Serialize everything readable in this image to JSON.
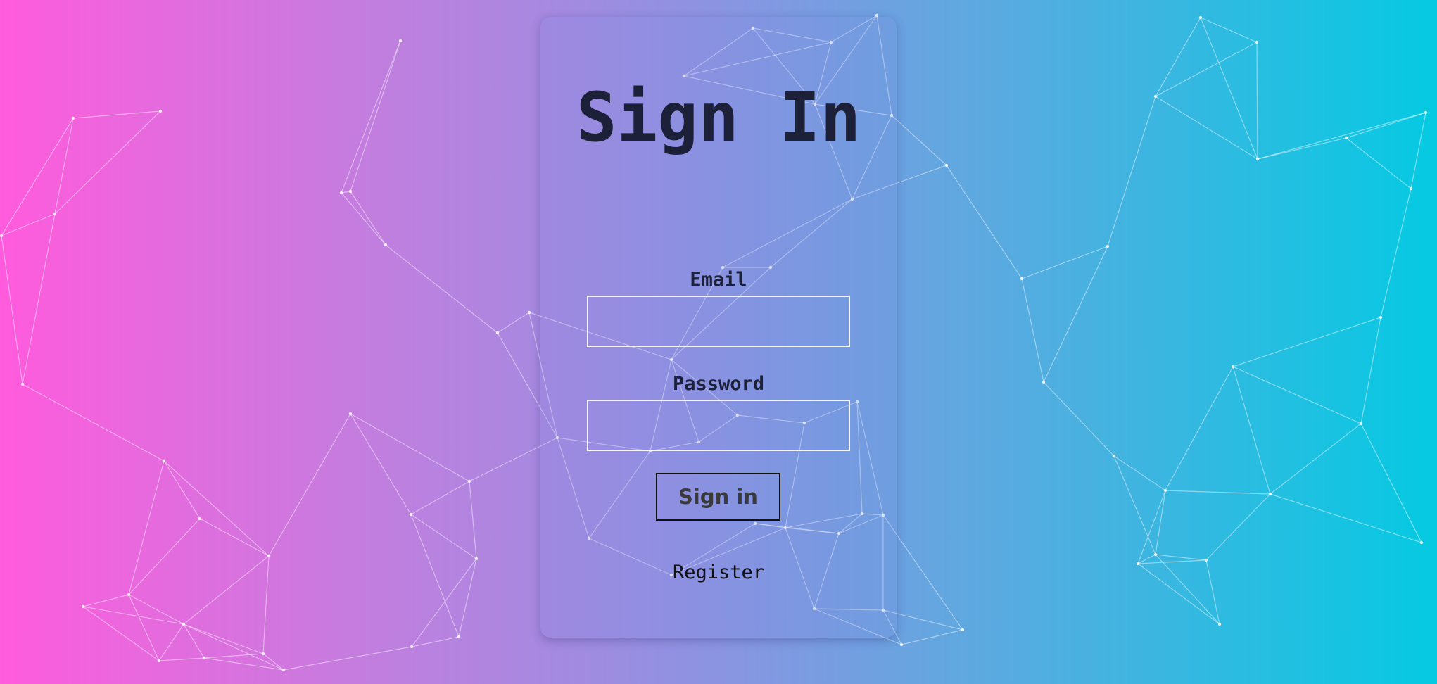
{
  "background": {
    "gradient_colors": [
      "#ff5bdc",
      "#c47ddf",
      "#8f92e1",
      "#58abe0",
      "#05cae2"
    ],
    "decoration": "particle-network"
  },
  "signin_form": {
    "title": "Sign In",
    "email_label": "Email",
    "email_value": "",
    "password_label": "Password",
    "password_value": "",
    "submit_label": "Sign in",
    "register_label": "Register"
  }
}
